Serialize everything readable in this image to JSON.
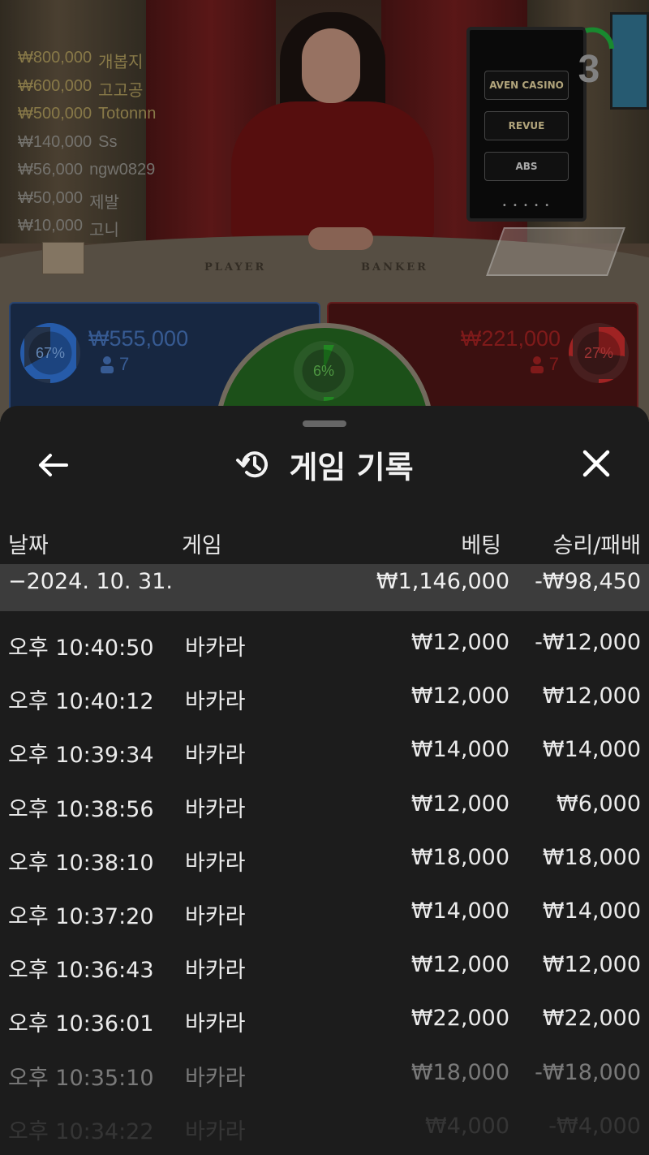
{
  "live_game": {
    "countdown": "3",
    "table_labels": {
      "player": "PLAYER",
      "banker": "BANKER"
    },
    "monitor": {
      "sponsors": [
        "AVEN CASINO",
        "REVUE",
        "ABS"
      ],
      "pager": "• • • • •"
    },
    "bet_feed": [
      {
        "amount": "₩800,000",
        "user": "개봅지"
      },
      {
        "amount": "₩600,000",
        "user": "고고공"
      },
      {
        "amount": "₩500,000",
        "user": "Totonnn"
      },
      {
        "amount": "₩140,000",
        "user": "Ss"
      },
      {
        "amount": "₩56,000",
        "user": "ngw0829"
      },
      {
        "amount": "₩50,000",
        "user": "제발"
      },
      {
        "amount": "₩10,000",
        "user": "고니"
      }
    ],
    "player_spot": {
      "percent": "67%",
      "percent_value": 0.67,
      "amount": "₩555,000",
      "players": "7"
    },
    "banker_spot": {
      "percent": "27%",
      "percent_value": 0.27,
      "amount": "₩221,000",
      "players": "7"
    },
    "tie_spot": {
      "percent": "6%",
      "percent_value": 0.06
    },
    "colors": {
      "player": "#33548a",
      "banker": "#7a2424",
      "tie": "#23621f",
      "countdown_arc": "#1fa83a"
    }
  },
  "history_panel": {
    "title": "게임 기록",
    "icons": {
      "back": "arrow-left-icon",
      "title": "history-icon",
      "close": "close-icon"
    },
    "columns": {
      "date": "날짜",
      "game": "게임",
      "bet": "베팅",
      "result": "승리/패배"
    },
    "date_group": {
      "label": "−2024. 10. 31.",
      "bet_total": "₩1,146,000",
      "result_total": "-₩98,450"
    },
    "rows": [
      {
        "time": "오후 10:40:50",
        "game": "바카라",
        "bet": "₩12,000",
        "result": "-₩12,000"
      },
      {
        "time": "오후 10:40:12",
        "game": "바카라",
        "bet": "₩12,000",
        "result": "₩12,000"
      },
      {
        "time": "오후 10:39:34",
        "game": "바카라",
        "bet": "₩14,000",
        "result": "₩14,000"
      },
      {
        "time": "오후 10:38:56",
        "game": "바카라",
        "bet": "₩12,000",
        "result": "₩6,000"
      },
      {
        "time": "오후 10:38:10",
        "game": "바카라",
        "bet": "₩18,000",
        "result": "₩18,000"
      },
      {
        "time": "오후 10:37:20",
        "game": "바카라",
        "bet": "₩14,000",
        "result": "₩14,000"
      },
      {
        "time": "오후 10:36:43",
        "game": "바카라",
        "bet": "₩12,000",
        "result": "₩12,000"
      },
      {
        "time": "오후 10:36:01",
        "game": "바카라",
        "bet": "₩22,000",
        "result": "₩22,000"
      },
      {
        "time": "오후 10:35:10",
        "game": "바카라",
        "bet": "₩18,000",
        "result": "-₩18,000"
      },
      {
        "time": "오후 10:34:22",
        "game": "바카라",
        "bet": "₩4,000",
        "result": "-₩4,000"
      }
    ]
  }
}
